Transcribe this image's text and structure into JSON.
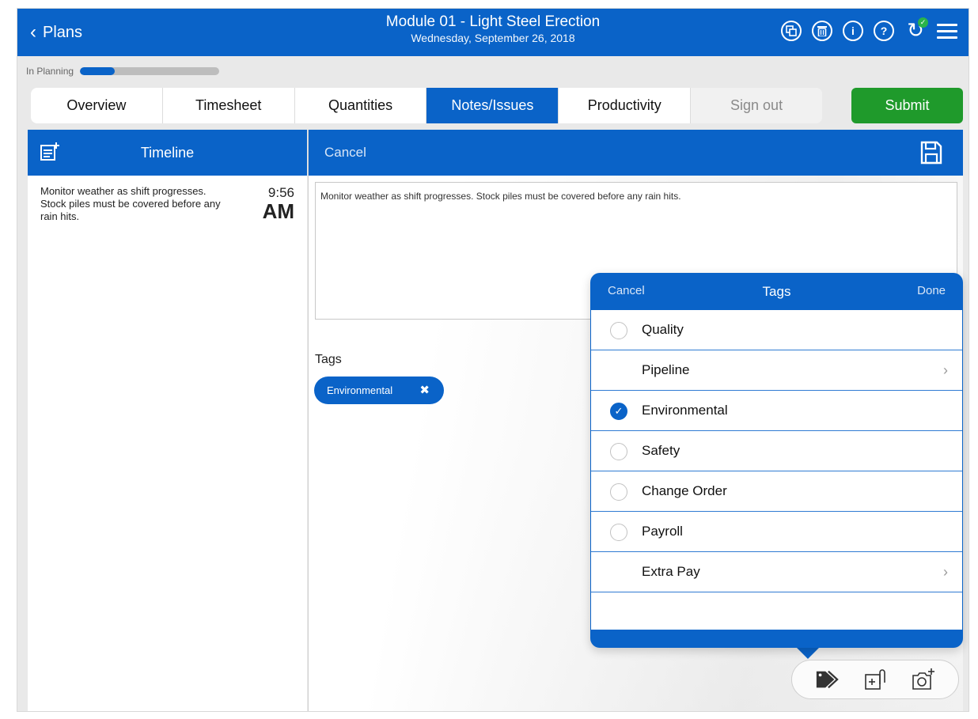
{
  "header": {
    "back_label": "Plans",
    "title": "Module 01 - Light Steel Erection",
    "date": "Wednesday, September 26, 2018",
    "icons": [
      "copy-icon",
      "trash-icon",
      "info-icon",
      "help-icon",
      "sync-icon",
      "menu-icon"
    ]
  },
  "status": {
    "label": "In Planning",
    "progress": 0.25
  },
  "tabs": [
    {
      "label": "Overview"
    },
    {
      "label": "Timesheet"
    },
    {
      "label": "Quantities"
    },
    {
      "label": "Notes/Issues",
      "active": true
    },
    {
      "label": "Productivity"
    },
    {
      "label": "Sign out",
      "disabled": true
    }
  ],
  "submit_label": "Submit",
  "timeline": {
    "title": "Timeline",
    "entries": [
      {
        "text": "Monitor weather as shift progresses. Stock piles must be covered before any rain hits.",
        "time": "9:56",
        "ampm": "AM"
      }
    ]
  },
  "editor": {
    "cancel_label": "Cancel",
    "note_text": "Monitor weather as shift progresses. Stock piles must be covered before any rain hits.",
    "tags_label": "Tags",
    "chips": [
      "Environmental"
    ]
  },
  "tag_picker": {
    "cancel_label": "Cancel",
    "title": "Tags",
    "done_label": "Done",
    "options": [
      {
        "label": "Quality",
        "type": "radio",
        "checked": false
      },
      {
        "label": "Pipeline",
        "type": "group"
      },
      {
        "label": "Environmental",
        "type": "radio",
        "checked": true
      },
      {
        "label": "Safety",
        "type": "radio",
        "checked": false
      },
      {
        "label": "Change Order",
        "type": "radio",
        "checked": false
      },
      {
        "label": "Payroll",
        "type": "radio",
        "checked": false
      },
      {
        "label": "Extra Pay",
        "type": "group"
      }
    ]
  },
  "colors": {
    "primary": "#0a63c8",
    "submit": "#1f9a2b",
    "sync_ok": "#29b34a"
  }
}
